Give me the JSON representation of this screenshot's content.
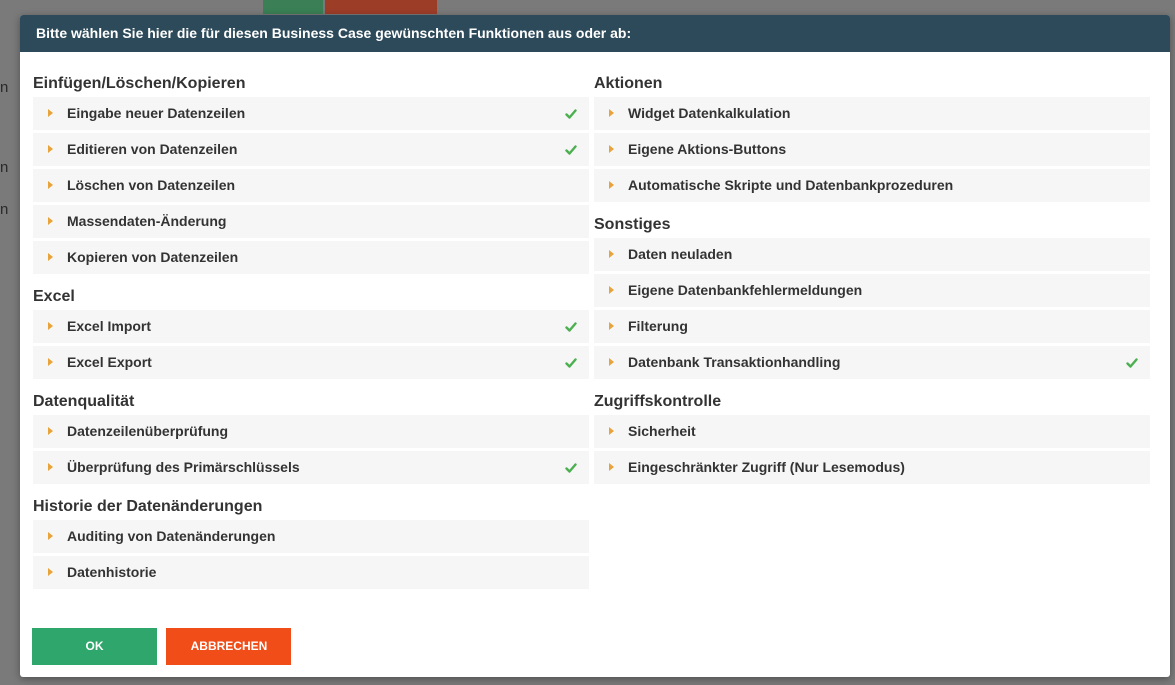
{
  "dialog": {
    "title": "Bitte wählen Sie hier die für diesen Business Case gewünschten Funktionen aus oder ab:",
    "ok_label": "OK",
    "cancel_label": "ABBRECHEN"
  },
  "columns": [
    {
      "sections": [
        {
          "title": "Einfügen/Löschen/Kopieren",
          "items": [
            {
              "label": "Eingabe neuer Datenzeilen",
              "checked": true
            },
            {
              "label": "Editieren von Datenzeilen",
              "checked": true
            },
            {
              "label": "Löschen von Datenzeilen",
              "checked": false
            },
            {
              "label": "Massendaten-Änderung",
              "checked": false
            },
            {
              "label": "Kopieren von Datenzeilen",
              "checked": false
            }
          ]
        },
        {
          "title": "Excel",
          "items": [
            {
              "label": "Excel Import",
              "checked": true
            },
            {
              "label": "Excel Export",
              "checked": true
            }
          ]
        },
        {
          "title": "Datenqualität",
          "items": [
            {
              "label": "Datenzeilenüberprüfung",
              "checked": false
            },
            {
              "label": "Überprüfung des Primärschlüssels",
              "checked": true
            }
          ]
        },
        {
          "title": "Historie der Datenänderungen",
          "items": [
            {
              "label": "Auditing von Datenänderungen",
              "checked": false
            },
            {
              "label": "Datenhistorie",
              "checked": false
            }
          ]
        }
      ]
    },
    {
      "sections": [
        {
          "title": "Aktionen",
          "items": [
            {
              "label": "Widget Datenkalkulation",
              "checked": false
            },
            {
              "label": "Eigene Aktions-Buttons",
              "checked": false
            },
            {
              "label": "Automatische Skripte und Datenbankprozeduren",
              "checked": false
            }
          ]
        },
        {
          "title": "Sonstiges",
          "items": [
            {
              "label": "Daten neuladen",
              "checked": false
            },
            {
              "label": "Eigene Datenbankfehlermeldungen",
              "checked": false
            },
            {
              "label": "Filterung",
              "checked": false
            },
            {
              "label": "Datenbank Transaktionhandling",
              "checked": true
            }
          ]
        },
        {
          "title": "Zugriffskontrolle",
          "items": [
            {
              "label": "Sicherheit",
              "checked": false
            },
            {
              "label": "Eingeschränkter Zugriff (Nur Lesemodus)",
              "checked": false
            }
          ]
        }
      ]
    }
  ],
  "colors": {
    "header_bg": "#2d4a5a",
    "ok_button": "#2fa66b",
    "cancel_button": "#f04d18",
    "arrow": "#e8a33a",
    "check": "#4caf50"
  },
  "icons": {
    "expand": "caret-right-icon",
    "checked": "checkmark-icon"
  }
}
